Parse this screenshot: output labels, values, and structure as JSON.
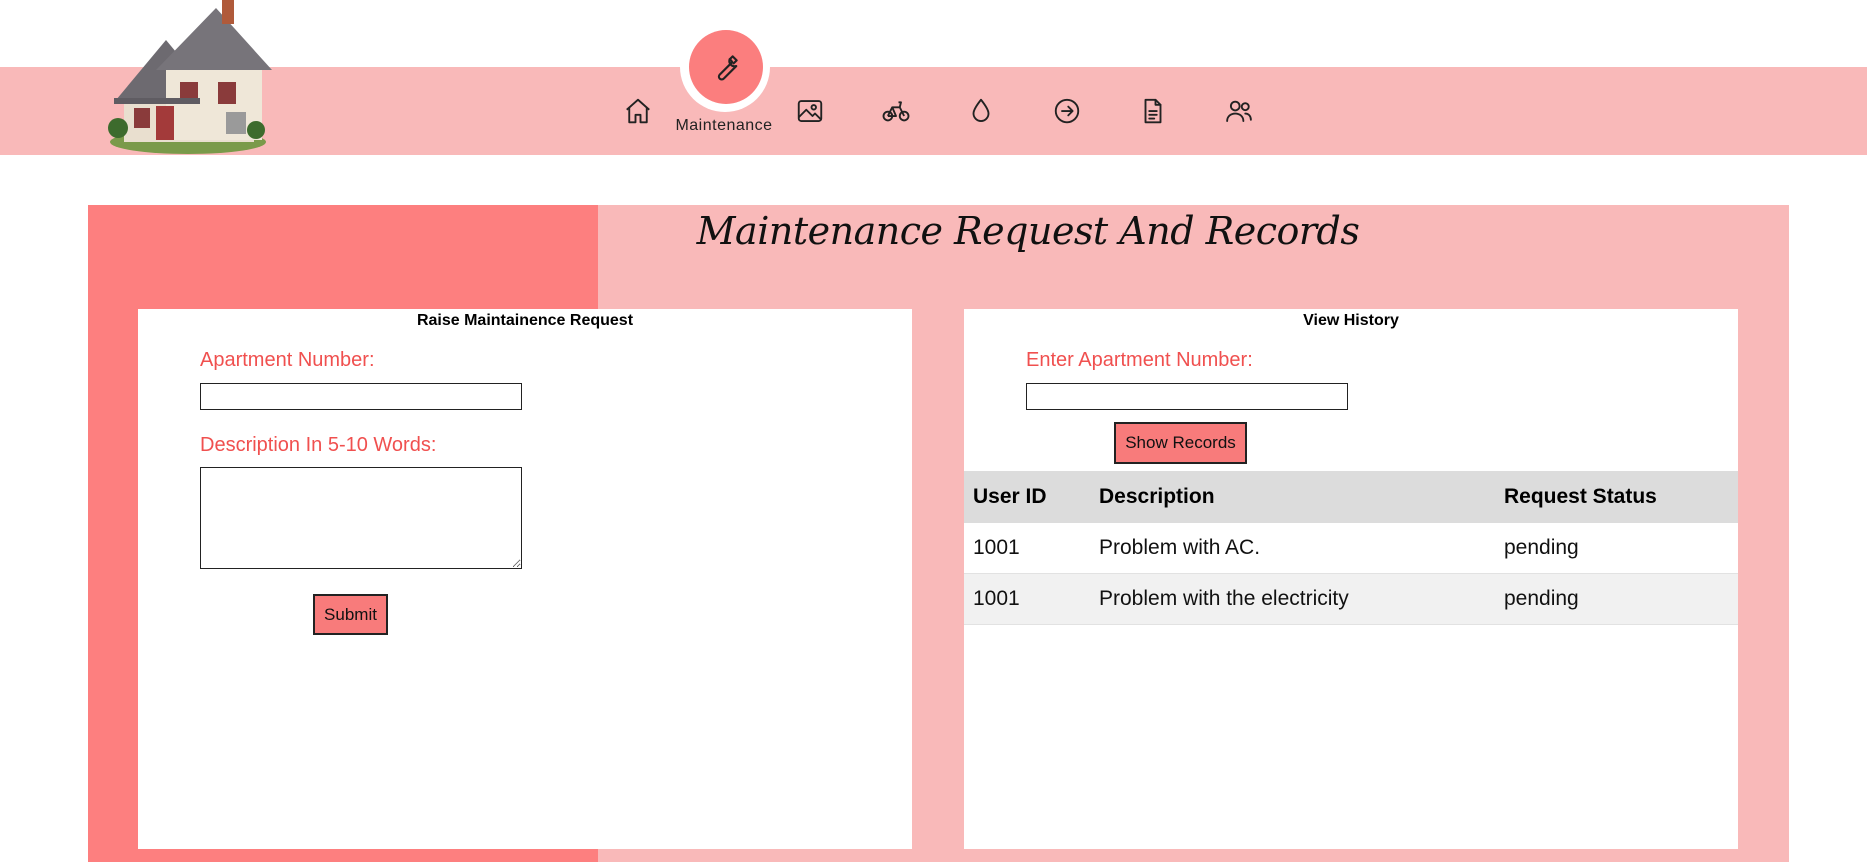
{
  "nav": {
    "active_label": "Maintenance",
    "items": [
      {
        "icon": "home-icon",
        "label": ""
      },
      {
        "icon": "wrench-icon",
        "label": "Maintenance"
      },
      {
        "icon": "image-icon",
        "label": ""
      },
      {
        "icon": "bicycle-icon",
        "label": ""
      },
      {
        "icon": "water-drop-icon",
        "label": ""
      },
      {
        "icon": "arrow-circle-right-icon",
        "label": ""
      },
      {
        "icon": "document-icon",
        "label": ""
      },
      {
        "icon": "users-icon",
        "label": ""
      }
    ]
  },
  "page": {
    "title": "Maintenance Request And Records"
  },
  "raise_form": {
    "heading": "Raise Maintainence Request",
    "apartment_label": "Apartment Number:",
    "apartment_value": "",
    "description_label": "Description In 5-10 Words:",
    "description_value": "",
    "submit_label": "Submit"
  },
  "history": {
    "heading": "View History",
    "apartment_label": "Enter Apartment Number:",
    "apartment_value": "",
    "show_button_label": "Show Records",
    "columns": [
      "User ID",
      "Description",
      "Request Status"
    ],
    "rows": [
      {
        "user_id": "1001",
        "description": "Problem with AC.",
        "status": "pending"
      },
      {
        "user_id": "1001",
        "description": "Problem with the electricity",
        "status": "pending"
      }
    ]
  },
  "colors": {
    "nav_band": "#f9b9b9",
    "accent": "#fd7f7f",
    "label_red": "#f0504f",
    "button": "#f87b7b"
  }
}
